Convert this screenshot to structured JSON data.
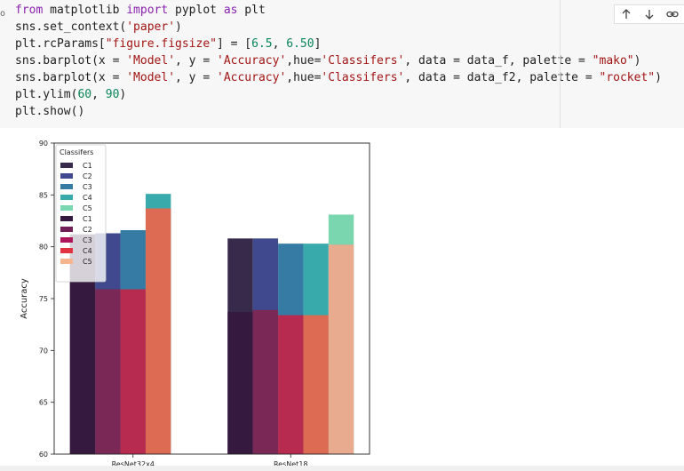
{
  "cell": {
    "gutter_mark": "o",
    "code_lines": [
      [
        {
          "t": "from",
          "c": "kw"
        },
        {
          "t": " matplotlib "
        },
        {
          "t": "import",
          "c": "kw"
        },
        {
          "t": " pyplot "
        },
        {
          "t": "as",
          "c": "kw"
        },
        {
          "t": " plt"
        }
      ],
      [
        {
          "t": "sns.set_context("
        },
        {
          "t": "'paper'",
          "c": "str"
        },
        {
          "t": ")"
        }
      ],
      [
        {
          "t": "plt.rcParams["
        },
        {
          "t": "\"figure.figsize\"",
          "c": "str"
        },
        {
          "t": "] = ["
        },
        {
          "t": "6.5",
          "c": "num"
        },
        {
          "t": ", "
        },
        {
          "t": "6.50",
          "c": "num"
        },
        {
          "t": "]"
        }
      ],
      [
        {
          "t": "sns.barplot(x = "
        },
        {
          "t": "'Model'",
          "c": "str"
        },
        {
          "t": ", y = "
        },
        {
          "t": "'Accuracy'",
          "c": "str"
        },
        {
          "t": ",hue="
        },
        {
          "t": "'Classifers'",
          "c": "str"
        },
        {
          "t": ", data = data_f, palette = "
        },
        {
          "t": "\"mako\"",
          "c": "str"
        },
        {
          "t": ")"
        }
      ],
      [
        {
          "t": "sns.barplot(x = "
        },
        {
          "t": "'Model'",
          "c": "str"
        },
        {
          "t": ", y = "
        },
        {
          "t": "'Accuracy'",
          "c": "str"
        },
        {
          "t": ",hue="
        },
        {
          "t": "'Classifers'",
          "c": "str"
        },
        {
          "t": ", data = data_f2, palette = "
        },
        {
          "t": "\"rocket\"",
          "c": "str"
        },
        {
          "t": ")"
        }
      ],
      [
        {
          "t": "plt.ylim("
        },
        {
          "t": "60",
          "c": "num"
        },
        {
          "t": ", "
        },
        {
          "t": "90",
          "c": "num"
        },
        {
          "t": ")"
        }
      ],
      [
        {
          "t": "plt.show()"
        }
      ]
    ],
    "toolbar": {
      "move_up_icon": "arrow-up-icon",
      "move_down_icon": "arrow-down-icon",
      "link_icon": "link-icon"
    }
  },
  "chart_data": {
    "type": "bar",
    "categories": [
      "ResNet32x4",
      "ResNet18"
    ],
    "ylabel": "Accuracy",
    "xlabel": "",
    "ylim": [
      60,
      90
    ],
    "yticks": [
      60,
      65,
      70,
      75,
      80,
      85,
      90
    ],
    "legend_title": "Classifers",
    "legend_position": "top-left",
    "grid": false,
    "layers": [
      {
        "palette": "mako",
        "series": [
          {
            "name": "C1",
            "color": "#382a4b",
            "values": [
              81.2,
              80.8
            ]
          },
          {
            "name": "C2",
            "color": "#40498e",
            "values": [
              81.3,
              80.8
            ]
          },
          {
            "name": "C3",
            "color": "#357ba3",
            "values": [
              81.6,
              80.3
            ]
          },
          {
            "name": "C4",
            "color": "#38aaac",
            "values": [
              85.1,
              80.3
            ]
          },
          {
            "name": "C5",
            "color": "#79d6ae",
            "values": [
              0,
              83.1
            ]
          }
        ]
      },
      {
        "palette": "rocket",
        "series": [
          {
            "name": "C1",
            "color": "#35193e",
            "values": [
              81.1,
              73.7
            ]
          },
          {
            "name": "C2",
            "color": "#701f57",
            "values": [
              75.9,
              73.9
            ]
          },
          {
            "name": "C3",
            "color": "#ad1759",
            "values": [
              75.9,
              73.4
            ]
          },
          {
            "name": "C4",
            "color": "#e13342",
            "values": [
              83.7,
              73.4
            ]
          },
          {
            "name": "C5",
            "color": "#f37651",
            "values": [
              0,
              80.2
            ]
          }
        ]
      }
    ],
    "legend_colors_rocket": [
      "#35193e",
      "#701f57",
      "#ad1759",
      "#e13342",
      "#f6b48f"
    ],
    "top_layer_colors_rocket_alt": [
      "#35193e",
      "#7a2956",
      "#b82b51",
      "#dd6a52",
      "#e8ab8f"
    ]
  }
}
